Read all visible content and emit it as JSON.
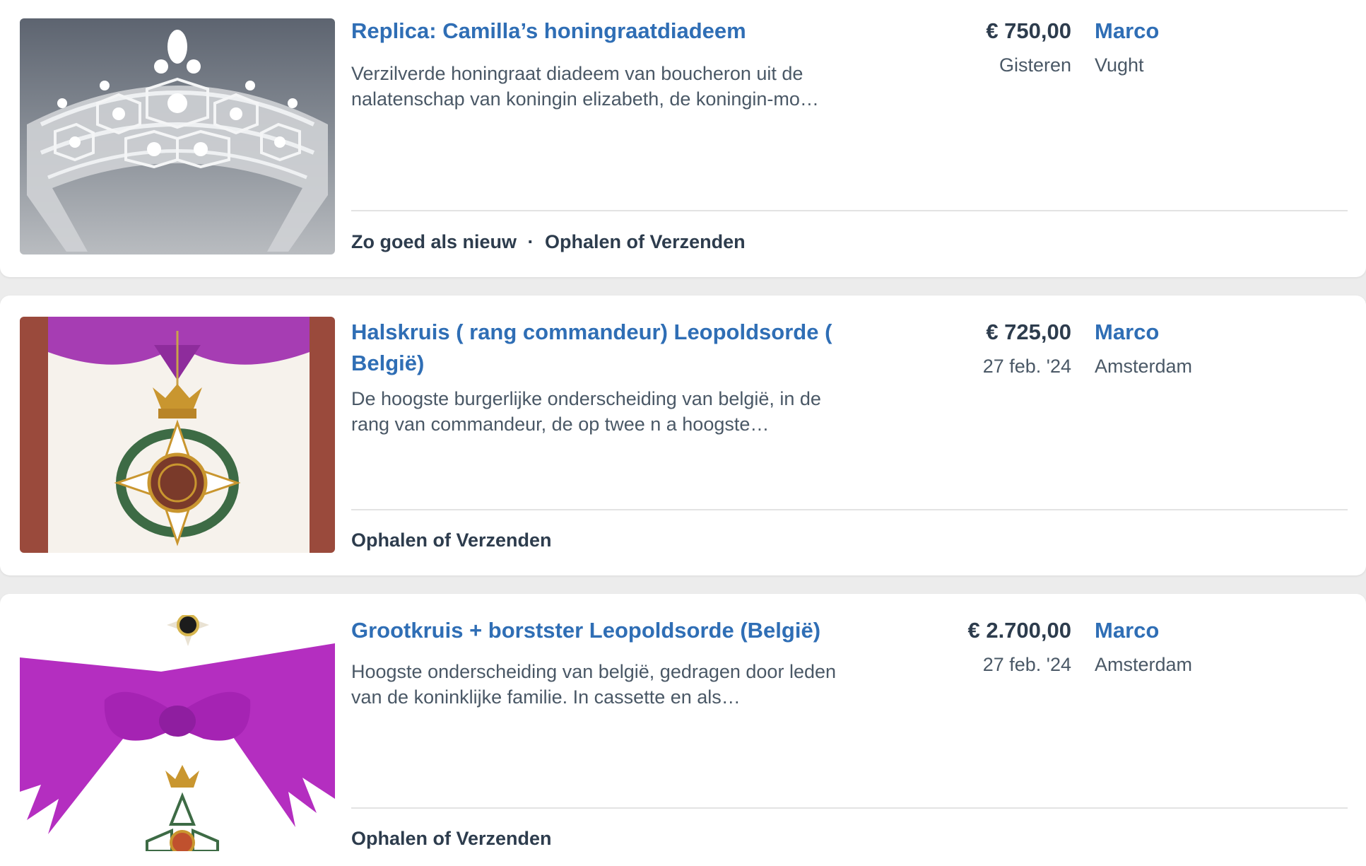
{
  "listings": [
    {
      "title": "Replica: Camilla’s honingraatdiadeem",
      "description": "Verzilverde honingraat diadeem van boucheron uit de nalatenschap van koningin elizabeth, de koningin-mo…",
      "price": "€ 750,00",
      "date": "Gisteren",
      "seller": "Marco",
      "city": "Vught",
      "condition": "Zo goed als nieuw",
      "separator": "·",
      "delivery": "Ophalen of Verzenden",
      "image": "tiara-photo"
    },
    {
      "title": "Halskruis ( rang commandeur) Leopoldsorde ( België)",
      "description": "De hoogste burgerlijke onderscheiding van belgië, in de rang van commandeur, de op twee n a hoogste…",
      "price": "€ 725,00",
      "date": "27 feb. '24",
      "seller": "Marco",
      "city": "Amsterdam",
      "delivery": "Ophalen of Verzenden",
      "image": "neck-cross-medal-photo"
    },
    {
      "title": "Grootkruis + borstster Leopoldsorde (België)",
      "description": "Hoogste onderscheiding van belgië, gedragen door leden van de koninklijke familie. In cassette en als…",
      "price": "€ 2.700,00",
      "date": "27 feb. '24",
      "seller": "Marco",
      "city": "Amsterdam",
      "delivery": "Ophalen of Verzenden",
      "image": "grand-cross-sash-photo"
    }
  ],
  "colors": {
    "link": "#2f6eb5",
    "text": "#2d3c4d",
    "muted": "#4a5866",
    "sash": "#b22bbd"
  }
}
